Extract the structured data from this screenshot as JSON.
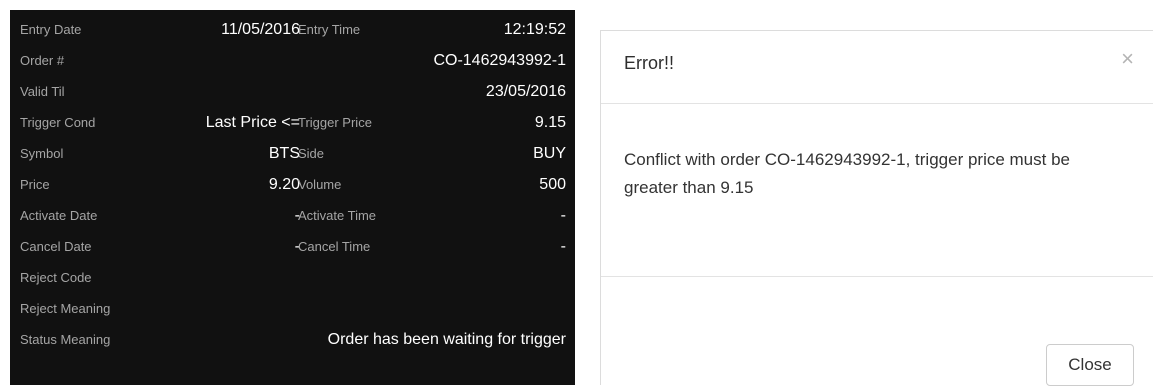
{
  "order": {
    "rows": [
      {
        "label1": "Entry Date",
        "value1": "11/05/2016",
        "label2": "Entry Time",
        "value2": "12:19:52"
      },
      {
        "label1": "Order #",
        "value_wide": "CO-1462943992-1"
      },
      {
        "label1": "Valid Til",
        "value_wide": "23/05/2016"
      },
      {
        "label1": "Trigger Cond",
        "value1": "Last Price <=",
        "label2": "Trigger Price",
        "value2": "9.15"
      },
      {
        "label1": "Symbol",
        "value1": "BTS",
        "label2": "Side",
        "value2": "BUY"
      },
      {
        "label1": "Price",
        "value1": "9.20",
        "label2": "Volume",
        "value2": "500"
      },
      {
        "label1": "Activate Date",
        "value1": "-",
        "label2": "Activate Time",
        "value2": "-"
      },
      {
        "label1": "Cancel Date",
        "value1": "-",
        "label2": "Cancel Time",
        "value2": "-"
      },
      {
        "label1": "Reject Code"
      },
      {
        "label1": "Reject Meaning"
      },
      {
        "label1": "Status Meaning",
        "value_wide": "Order has been waiting for trigger"
      }
    ]
  },
  "modal": {
    "title": "Error!!",
    "close_icon": "×",
    "message": "Conflict with order CO-1462943992-1, trigger price must be greater than 9.15",
    "close_button": "Close"
  }
}
